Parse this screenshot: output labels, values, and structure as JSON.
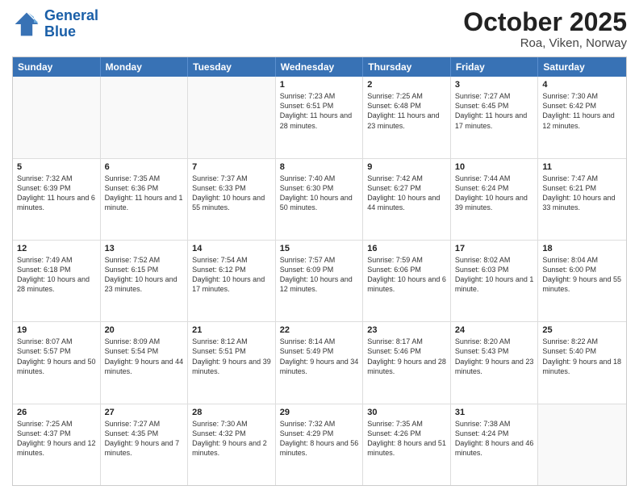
{
  "header": {
    "logo_line1": "General",
    "logo_line2": "Blue",
    "title": "October 2025",
    "subtitle": "Roa, Viken, Norway"
  },
  "days_of_week": [
    "Sunday",
    "Monday",
    "Tuesday",
    "Wednesday",
    "Thursday",
    "Friday",
    "Saturday"
  ],
  "weeks": [
    [
      {
        "day": "",
        "empty": true
      },
      {
        "day": "",
        "empty": true
      },
      {
        "day": "",
        "empty": true
      },
      {
        "day": "1",
        "sunrise": "7:23 AM",
        "sunset": "6:51 PM",
        "daylight": "11 hours and 28 minutes."
      },
      {
        "day": "2",
        "sunrise": "7:25 AM",
        "sunset": "6:48 PM",
        "daylight": "11 hours and 23 minutes."
      },
      {
        "day": "3",
        "sunrise": "7:27 AM",
        "sunset": "6:45 PM",
        "daylight": "11 hours and 17 minutes."
      },
      {
        "day": "4",
        "sunrise": "7:30 AM",
        "sunset": "6:42 PM",
        "daylight": "11 hours and 12 minutes."
      }
    ],
    [
      {
        "day": "5",
        "sunrise": "7:32 AM",
        "sunset": "6:39 PM",
        "daylight": "11 hours and 6 minutes."
      },
      {
        "day": "6",
        "sunrise": "7:35 AM",
        "sunset": "6:36 PM",
        "daylight": "11 hours and 1 minute."
      },
      {
        "day": "7",
        "sunrise": "7:37 AM",
        "sunset": "6:33 PM",
        "daylight": "10 hours and 55 minutes."
      },
      {
        "day": "8",
        "sunrise": "7:40 AM",
        "sunset": "6:30 PM",
        "daylight": "10 hours and 50 minutes."
      },
      {
        "day": "9",
        "sunrise": "7:42 AM",
        "sunset": "6:27 PM",
        "daylight": "10 hours and 44 minutes."
      },
      {
        "day": "10",
        "sunrise": "7:44 AM",
        "sunset": "6:24 PM",
        "daylight": "10 hours and 39 minutes."
      },
      {
        "day": "11",
        "sunrise": "7:47 AM",
        "sunset": "6:21 PM",
        "daylight": "10 hours and 33 minutes."
      }
    ],
    [
      {
        "day": "12",
        "sunrise": "7:49 AM",
        "sunset": "6:18 PM",
        "daylight": "10 hours and 28 minutes."
      },
      {
        "day": "13",
        "sunrise": "7:52 AM",
        "sunset": "6:15 PM",
        "daylight": "10 hours and 23 minutes."
      },
      {
        "day": "14",
        "sunrise": "7:54 AM",
        "sunset": "6:12 PM",
        "daylight": "10 hours and 17 minutes."
      },
      {
        "day": "15",
        "sunrise": "7:57 AM",
        "sunset": "6:09 PM",
        "daylight": "10 hours and 12 minutes."
      },
      {
        "day": "16",
        "sunrise": "7:59 AM",
        "sunset": "6:06 PM",
        "daylight": "10 hours and 6 minutes."
      },
      {
        "day": "17",
        "sunrise": "8:02 AM",
        "sunset": "6:03 PM",
        "daylight": "10 hours and 1 minute."
      },
      {
        "day": "18",
        "sunrise": "8:04 AM",
        "sunset": "6:00 PM",
        "daylight": "9 hours and 55 minutes."
      }
    ],
    [
      {
        "day": "19",
        "sunrise": "8:07 AM",
        "sunset": "5:57 PM",
        "daylight": "9 hours and 50 minutes."
      },
      {
        "day": "20",
        "sunrise": "8:09 AM",
        "sunset": "5:54 PM",
        "daylight": "9 hours and 44 minutes."
      },
      {
        "day": "21",
        "sunrise": "8:12 AM",
        "sunset": "5:51 PM",
        "daylight": "9 hours and 39 minutes."
      },
      {
        "day": "22",
        "sunrise": "8:14 AM",
        "sunset": "5:49 PM",
        "daylight": "9 hours and 34 minutes."
      },
      {
        "day": "23",
        "sunrise": "8:17 AM",
        "sunset": "5:46 PM",
        "daylight": "9 hours and 28 minutes."
      },
      {
        "day": "24",
        "sunrise": "8:20 AM",
        "sunset": "5:43 PM",
        "daylight": "9 hours and 23 minutes."
      },
      {
        "day": "25",
        "sunrise": "8:22 AM",
        "sunset": "5:40 PM",
        "daylight": "9 hours and 18 minutes."
      }
    ],
    [
      {
        "day": "26",
        "sunrise": "7:25 AM",
        "sunset": "4:37 PM",
        "daylight": "9 hours and 12 minutes."
      },
      {
        "day": "27",
        "sunrise": "7:27 AM",
        "sunset": "4:35 PM",
        "daylight": "9 hours and 7 minutes."
      },
      {
        "day": "28",
        "sunrise": "7:30 AM",
        "sunset": "4:32 PM",
        "daylight": "9 hours and 2 minutes."
      },
      {
        "day": "29",
        "sunrise": "7:32 AM",
        "sunset": "4:29 PM",
        "daylight": "8 hours and 56 minutes."
      },
      {
        "day": "30",
        "sunrise": "7:35 AM",
        "sunset": "4:26 PM",
        "daylight": "8 hours and 51 minutes."
      },
      {
        "day": "31",
        "sunrise": "7:38 AM",
        "sunset": "4:24 PM",
        "daylight": "8 hours and 46 minutes."
      },
      {
        "day": "",
        "empty": true
      }
    ]
  ]
}
